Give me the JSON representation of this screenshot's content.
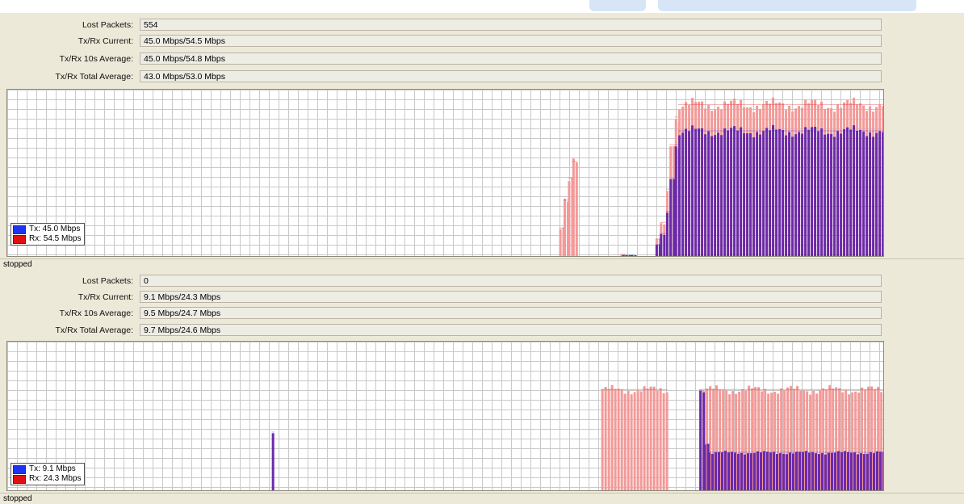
{
  "colors": {
    "tx": "#2233ee",
    "rx": "#dd1111",
    "tx_bar": "#6a2aa8",
    "rx_bar": "#f39a98",
    "grid": "#c9c9c9"
  },
  "panels": [
    {
      "fields": [
        {
          "label": "Lost Packets:",
          "value": "554"
        },
        {
          "label": "Tx/Rx Current:",
          "value": "45.0 Mbps/54.5 Mbps"
        },
        {
          "label": "Tx/Rx 10s Average:",
          "value": "45.0 Mbps/54.8 Mbps"
        },
        {
          "label": "Tx/Rx Total Average:",
          "value": "43.0 Mbps/53.0 Mbps"
        }
      ],
      "legend": {
        "tx": "Tx:  45.0 Mbps",
        "rx": "Rx:  54.5 Mbps"
      },
      "status": "stopped",
      "chart_data": {
        "type": "bar",
        "ylim": [
          0,
          60
        ],
        "series": [
          {
            "name": "Tx",
            "segments": [
              [
                0.702,
                0.712,
                0.2
              ],
              [
                0.712,
                0.716,
                0.2
              ],
              [
                0.74,
                0.745,
                4
              ],
              [
                0.745,
                0.752,
                8
              ],
              [
                0.752,
                0.756,
                16
              ],
              [
                0.756,
                0.762,
                28
              ],
              [
                0.762,
                0.766,
                40
              ],
              [
                0.766,
                1.0,
                45
              ]
            ]
          },
          {
            "name": "Rx",
            "segments": [
              [
                0.63,
                0.635,
                10
              ],
              [
                0.635,
                0.64,
                20
              ],
              [
                0.64,
                0.645,
                28
              ],
              [
                0.645,
                0.65,
                34
              ],
              [
                0.7,
                0.705,
                0.5
              ],
              [
                0.74,
                0.745,
                6
              ],
              [
                0.745,
                0.752,
                12
              ],
              [
                0.752,
                0.756,
                24
              ],
              [
                0.756,
                0.762,
                40
              ],
              [
                0.762,
                0.766,
                50
              ],
              [
                0.766,
                1.0,
                54.5
              ]
            ]
          }
        ]
      }
    },
    {
      "fields": [
        {
          "label": "Lost Packets:",
          "value": "0"
        },
        {
          "label": "Tx/Rx Current:",
          "value": "9.1 Mbps/24.3 Mbps"
        },
        {
          "label": "Tx/Rx 10s Average:",
          "value": "9.5 Mbps/24.7 Mbps"
        },
        {
          "label": "Tx/Rx Total Average:",
          "value": "9.7 Mbps/24.6 Mbps"
        }
      ],
      "legend": {
        "tx": "Tx:  9.1 Mbps",
        "rx": "Rx:  24.3 Mbps"
      },
      "status": "stopped",
      "chart_data": {
        "type": "bar",
        "ylim": [
          0,
          36
        ],
        "series": [
          {
            "name": "Tx",
            "segments": [
              [
                0.302,
                0.305,
                14
              ],
              [
                0.79,
                0.795,
                24
              ],
              [
                0.795,
                0.8,
                11
              ],
              [
                0.8,
                1.0,
                9.1
              ]
            ]
          },
          {
            "name": "Rx",
            "segments": [
              [
                0.678,
                0.754,
                24.3
              ],
              [
                0.79,
                1.0,
                24.3
              ]
            ]
          }
        ]
      }
    }
  ]
}
